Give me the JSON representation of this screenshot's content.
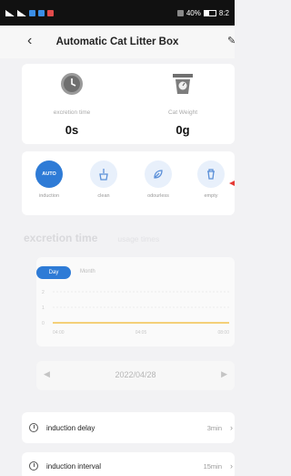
{
  "status_bar": {
    "battery": "40%",
    "time": "8:2"
  },
  "header": {
    "title": "Automatic Cat Litter Box"
  },
  "stats": [
    {
      "icon": "clock-icon",
      "label": "excretion time",
      "value": "0s"
    },
    {
      "icon": "scale-icon",
      "label": "Cat Weight",
      "value": "0g"
    }
  ],
  "modes": [
    {
      "label": "induction",
      "badge": "AUTO",
      "active": true
    },
    {
      "label": "clean",
      "icon": "broom-icon"
    },
    {
      "label": "odourless",
      "icon": "leaf-icon"
    },
    {
      "label": "empty",
      "icon": "trash-icon"
    }
  ],
  "tabs": {
    "active": "excretion time",
    "inactive": "usage times"
  },
  "period": {
    "day": "Day",
    "month": "Month"
  },
  "chart_data": {
    "type": "line",
    "x_ticks": [
      "04:00",
      "04:05",
      "08:00"
    ],
    "y_ticks": [
      "2",
      "1",
      "0"
    ],
    "series": [
      {
        "values": [
          0,
          0,
          0
        ],
        "color": "#f2c14e"
      }
    ]
  },
  "date_nav": {
    "date": "2022/04/28"
  },
  "settings": [
    {
      "label": "induction delay",
      "value": "3min"
    },
    {
      "label": "induction interval",
      "value": "15min"
    }
  ],
  "colors": {
    "accent": "#2e7bd6",
    "chart_line": "#f2c14e"
  }
}
